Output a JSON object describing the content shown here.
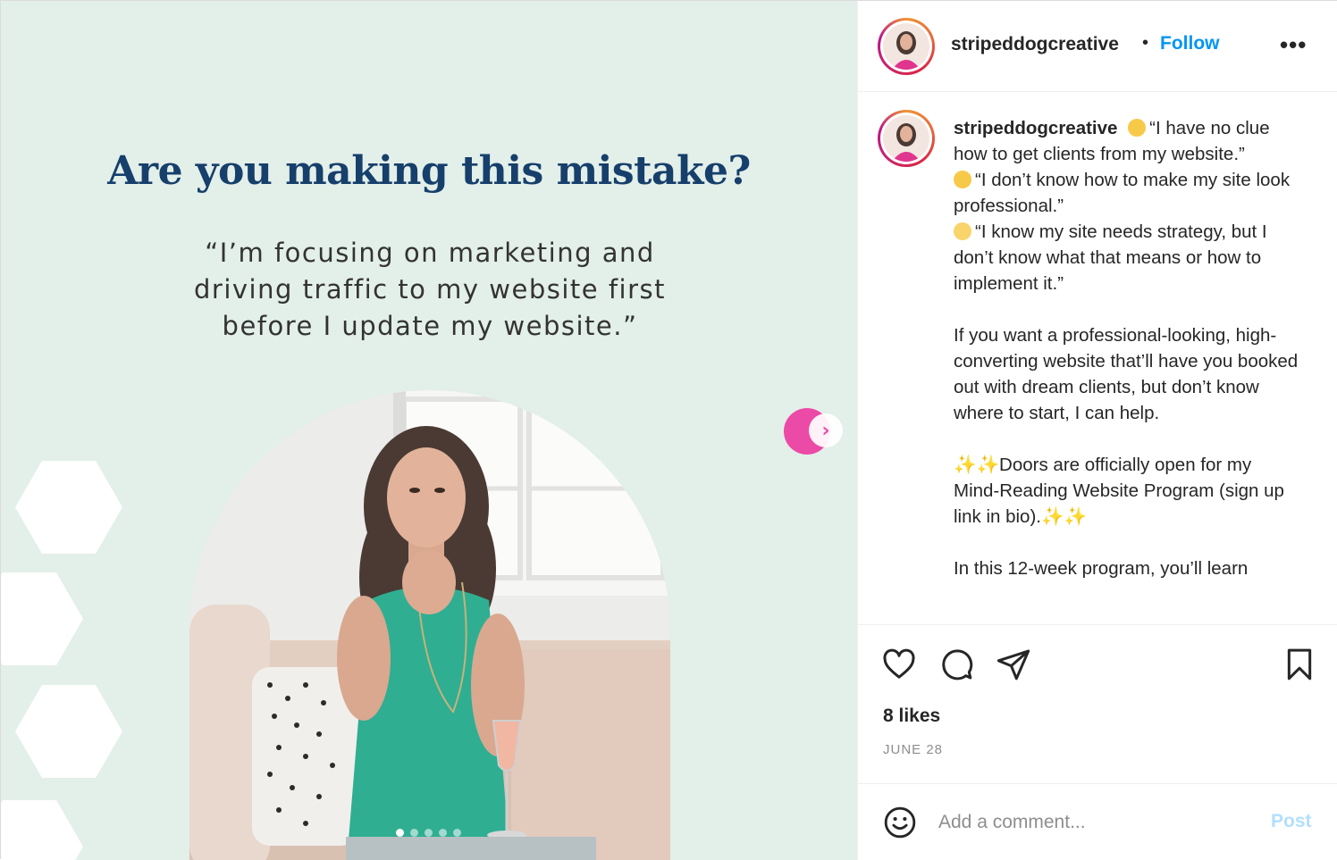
{
  "post": {
    "headline": "Are you making this mistake?",
    "quote": "“I’m focusing on marketing and driving traffic to my website first before I update my website.”",
    "carousel": {
      "slide_count": 5,
      "active_slide": 1
    }
  },
  "header": {
    "username": "stripeddogcreative",
    "separator": "•",
    "follow_label": "Follow",
    "more_label": "•••"
  },
  "caption": {
    "username": "stripeddogcreative",
    "lines": [
      {
        "emoji": "grimacing-emoji",
        "text": "“I have no clue how to get clients from my website.”"
      },
      {
        "emoji": "woozy-emoji",
        "text": "“I don’t know how to make my site look professional.”"
      },
      {
        "emoji": "hushed-emoji",
        "text": "“I know my site needs strategy, but I don’t know what that means or how to implement it.”"
      }
    ],
    "paragraph_1": "If you want a professional-looking, high-converting website that’ll have you booked out with dream clients, but don’t know where to start, I can help.",
    "paragraph_2": "✨✨Doors are officially open for my Mind-Reading Website Program (sign up link in bio).✨✨",
    "paragraph_3": "In this 12-week program, you’ll learn"
  },
  "engagement": {
    "likes": "8 likes",
    "date": "JUNE 28"
  },
  "comment": {
    "placeholder": "Add a comment...",
    "post_label": "Post"
  },
  "colors": {
    "media_bg": "#e3efe9",
    "headline": "#163f6b",
    "accent_pink": "#ec4aa7",
    "follow_blue": "#0095f6",
    "post_disabled": "#b2dffc"
  },
  "icons": [
    "heart-icon",
    "comment-icon",
    "share-icon",
    "bookmark-icon",
    "emoji-icon",
    "chevron-right-icon"
  ]
}
